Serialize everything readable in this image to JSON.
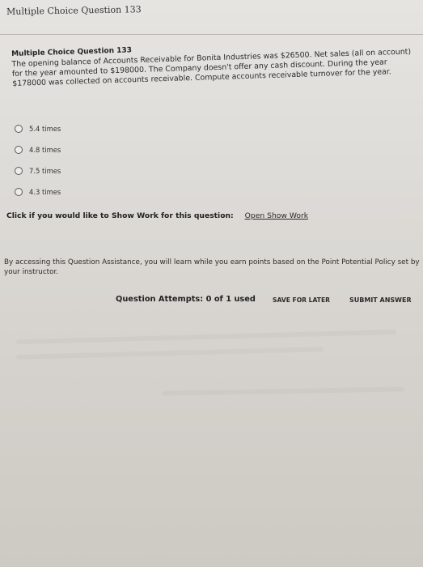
{
  "page": {
    "heading": "Multiple Choice Question 133"
  },
  "question": {
    "title": "Multiple Choice Question 133",
    "text": "The opening balance of Accounts Receivable for Bonita Industries was $26500. Net sales (all on account) for the year amounted to $198000. The Company doesn't offer any cash discount. During the year $178000 was collected on accounts receivable. Compute accounts receivable turnover for the year."
  },
  "options": [
    {
      "label": "5.4 times"
    },
    {
      "label": "4.8 times"
    },
    {
      "label": "7.5 times"
    },
    {
      "label": "4.3 times"
    }
  ],
  "show_work": {
    "prompt": "Click if you would like to Show Work for this question:",
    "link": "Open Show Work"
  },
  "assistance": {
    "text": "By accessing this Question Assistance, you will learn while you earn points based on the Point Potential Policy set by your instructor."
  },
  "footer": {
    "attempts": "Question Attempts: 0 of 1 used",
    "save_label": "SAVE FOR LATER",
    "submit_label": "SUBMIT ANSWER"
  }
}
